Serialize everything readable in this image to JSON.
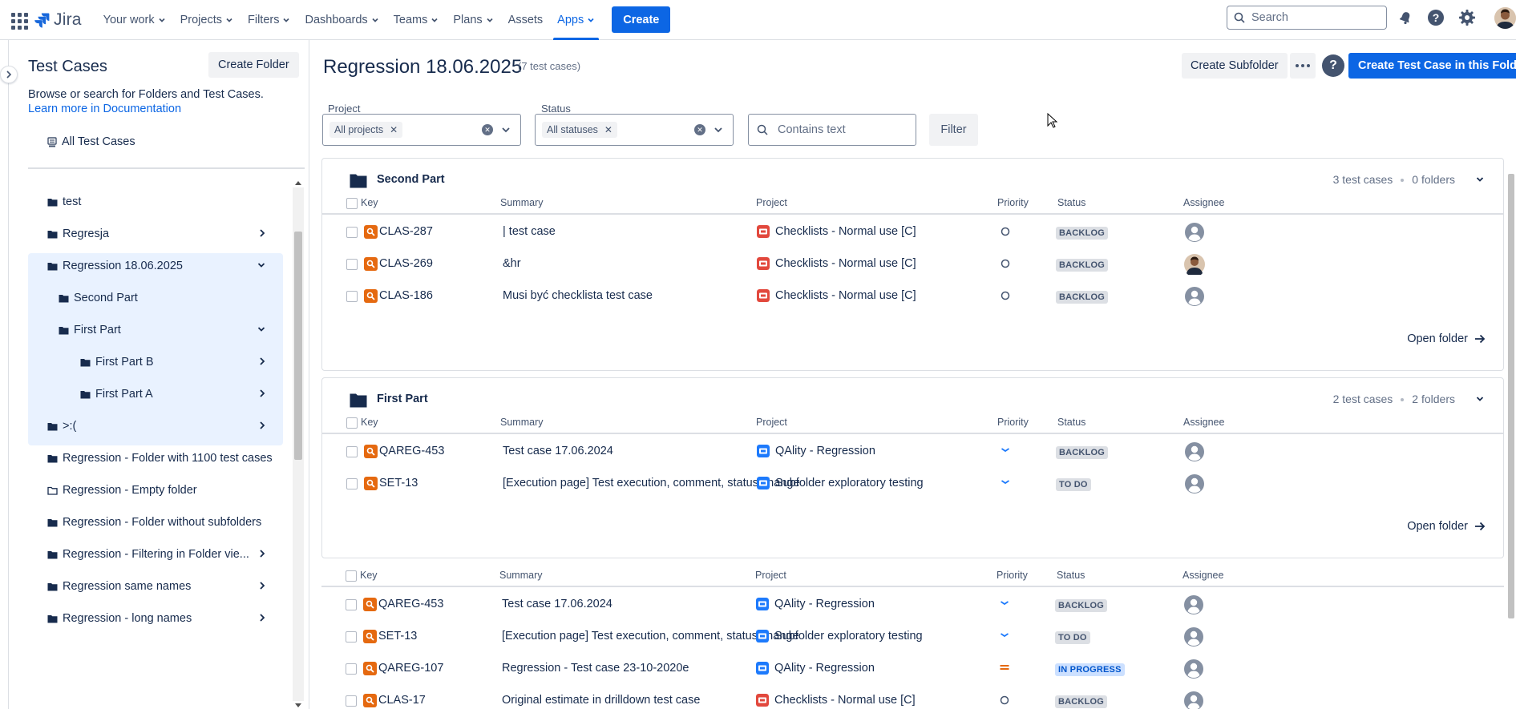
{
  "topnav": {
    "logo_text": "Jira",
    "items": [
      {
        "label": "Your work",
        "dropdown": true
      },
      {
        "label": "Projects",
        "dropdown": true
      },
      {
        "label": "Filters",
        "dropdown": true
      },
      {
        "label": "Dashboards",
        "dropdown": true
      },
      {
        "label": "Teams",
        "dropdown": true
      },
      {
        "label": "Plans",
        "dropdown": true
      },
      {
        "label": "Assets",
        "dropdown": false
      },
      {
        "label": "Apps",
        "dropdown": true,
        "active": true
      }
    ],
    "create_label": "Create",
    "search_placeholder": "Search",
    "icons": [
      "notifications-icon",
      "help-icon",
      "settings-icon",
      "profile-avatar"
    ]
  },
  "sidebar": {
    "title": "Test Cases",
    "create_folder_label": "Create Folder",
    "description": "Browse or search for Folders and Test Cases.",
    "doc_link": "Learn more in Documentation",
    "all_label": "All Test Cases",
    "tree": [
      {
        "label": "test",
        "level": 0,
        "arrow": "none",
        "icon": "folder-filled"
      },
      {
        "label": "Regresja",
        "level": 0,
        "arrow": "right",
        "icon": "folder-filled"
      },
      {
        "label": "Regression 18.06.2025",
        "level": 0,
        "arrow": "down",
        "icon": "folder-filled",
        "selected": true
      },
      {
        "label": "Second Part",
        "level": 1,
        "arrow": "none",
        "icon": "folder-filled",
        "selected": true
      },
      {
        "label": "First Part",
        "level": 1,
        "arrow": "down",
        "icon": "folder-filled",
        "selected": true
      },
      {
        "label": "First Part B",
        "level": 2,
        "arrow": "right",
        "icon": "folder-filled",
        "selected": true
      },
      {
        "label": "First Part A",
        "level": 2,
        "arrow": "right",
        "icon": "folder-filled",
        "selected": true
      },
      {
        "label": ">:(",
        "level": 0,
        "arrow": "right",
        "icon": "folder-filled"
      },
      {
        "label": "Regression - Folder with 1100 test cases",
        "level": 0,
        "arrow": "none",
        "icon": "folder-filled"
      },
      {
        "label": "Regression - Empty folder",
        "level": 0,
        "arrow": "none",
        "icon": "folder-outline"
      },
      {
        "label": "Regression - Folder without subfolders",
        "level": 0,
        "arrow": "none",
        "icon": "folder-filled"
      },
      {
        "label": "Regression - Filtering in Folder vie...",
        "level": 0,
        "arrow": "right",
        "icon": "folder-filled"
      },
      {
        "label": "Regression same names",
        "level": 0,
        "arrow": "right",
        "icon": "folder-filled"
      },
      {
        "label": "Regression - long names",
        "level": 0,
        "arrow": "right",
        "icon": "folder-filled"
      }
    ]
  },
  "main": {
    "title": "Regression 18.06.2025",
    "count": "(7 test cases)",
    "create_subfolder_label": "Create Subfolder",
    "create_test_case_label": "Create Test Case in this Folder",
    "filters": {
      "project_label": "Project",
      "project_chip": "All projects",
      "status_label": "Status",
      "status_chip": "All statuses",
      "text_placeholder": "Contains text",
      "filter_button": "Filter"
    },
    "columns": [
      "Key",
      "Summary",
      "Project",
      "Priority",
      "Status",
      "Assignee"
    ],
    "open_folder_label": "Open folder",
    "groups": [
      {
        "name": "Second Part",
        "test_cases_count": "3 test cases",
        "folders_count": "0 folders",
        "rows": [
          {
            "key": "CLAS-287",
            "summary": "| test case",
            "project": "Checklists - Normal use [C]",
            "project_color": "#e2483d",
            "priority": "none",
            "status": "BACKLOG",
            "status_style": "grey",
            "assignee": "default"
          },
          {
            "key": "CLAS-269",
            "summary": "&hr",
            "project": "Checklists - Normal use [C]",
            "project_color": "#e2483d",
            "priority": "none",
            "status": "BACKLOG",
            "status_style": "grey",
            "assignee": "photo"
          },
          {
            "key": "CLAS-186",
            "summary": "Musi być checklista test case",
            "project": "Checklists - Normal use [C]",
            "project_color": "#e2483d",
            "priority": "none",
            "status": "BACKLOG",
            "status_style": "grey",
            "assignee": "default"
          }
        ]
      },
      {
        "name": "First Part",
        "test_cases_count": "2 test cases",
        "folders_count": "2 folders",
        "rows": [
          {
            "key": "QAREG-453",
            "summary": "Test case 17.06.2024",
            "project": "QAlity - Regression",
            "project_color": "#1d7afc",
            "priority": "low",
            "status": "BACKLOG",
            "status_style": "grey",
            "assignee": "default"
          },
          {
            "key": "SET-13",
            "summary": "[Execution page] Test execution, comment, status change",
            "project": "Subfolder exploratory testing",
            "project_color": "#1d7afc",
            "priority": "low",
            "status": "TO DO",
            "status_style": "grey",
            "assignee": "default"
          }
        ]
      }
    ],
    "direct_rows": [
      {
        "key": "QAREG-453",
        "summary": "Test case 17.06.2024",
        "project": "QAlity - Regression",
        "project_color": "#1d7afc",
        "priority": "low",
        "status": "BACKLOG",
        "status_style": "grey",
        "assignee": "default"
      },
      {
        "key": "SET-13",
        "summary": "[Execution page] Test execution, comment, status change",
        "project": "Subfolder exploratory testing",
        "project_color": "#1d7afc",
        "priority": "low",
        "status": "TO DO",
        "status_style": "grey",
        "assignee": "default"
      },
      {
        "key": "QAREG-107",
        "summary": "Regression - Test case 23-10-2020e",
        "project": "QAlity - Regression",
        "project_color": "#1d7afc",
        "priority": "medium",
        "status": "IN PROGRESS",
        "status_style": "blue",
        "assignee": "default"
      },
      {
        "key": "CLAS-17",
        "summary": "Original estimate in drilldown test case",
        "project": "Checklists - Normal use [C]",
        "project_color": "#e2483d",
        "priority": "none",
        "status": "BACKLOG",
        "status_style": "grey",
        "assignee": "default"
      }
    ]
  },
  "colors": {
    "accent": "#0c66e4",
    "key_icon": "#e56910",
    "selected_bg": "#e9f2ff"
  }
}
